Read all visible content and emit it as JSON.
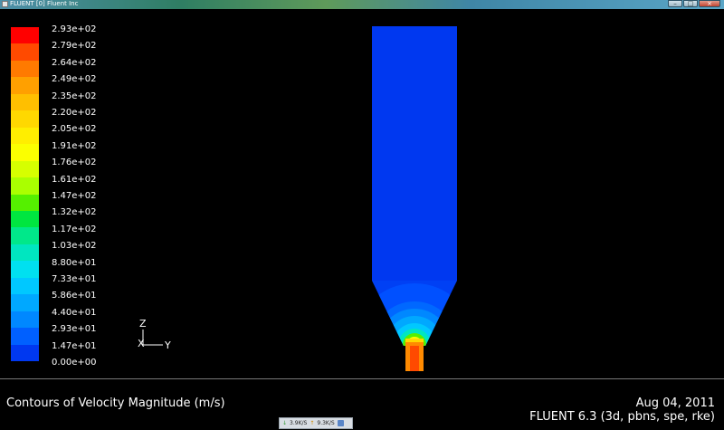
{
  "window": {
    "title": "FLUENT [0] Fluent Inc",
    "controls": [
      "minimize",
      "maximize",
      "close"
    ]
  },
  "colorbar": {
    "labels": [
      "2.93e+02",
      "2.79e+02",
      "2.64e+02",
      "2.49e+02",
      "2.35e+02",
      "2.20e+02",
      "2.05e+02",
      "1.91e+02",
      "1.76e+02",
      "1.61e+02",
      "1.47e+02",
      "1.32e+02",
      "1.17e+02",
      "1.03e+02",
      "8.80e+01",
      "7.33e+01",
      "5.86e+01",
      "4.40e+01",
      "2.93e+01",
      "1.47e+01",
      "0.00e+00"
    ],
    "colors": [
      "#ff0000",
      "#ff4a00",
      "#ff7a00",
      "#ffa000",
      "#ffbf00",
      "#ffd800",
      "#ffee00",
      "#fbff00",
      "#d6ff00",
      "#aaff00",
      "#55f000",
      "#00e640",
      "#00e88a",
      "#00e6c0",
      "#00e0f0",
      "#00c8ff",
      "#00a8ff",
      "#0088ff",
      "#0060ff",
      "#0038f0"
    ]
  },
  "axes": {
    "z": "Z",
    "x": "X",
    "y": "Y"
  },
  "footer": {
    "plot_title": "Contours of Velocity Magnitude (m/s)",
    "date": "Aug 04, 2011",
    "version": "FLUENT 6.3 (3d, pbns, spe, rke)"
  },
  "network_widget": {
    "down": "3.9K/S",
    "up": "9.3K/S"
  }
}
